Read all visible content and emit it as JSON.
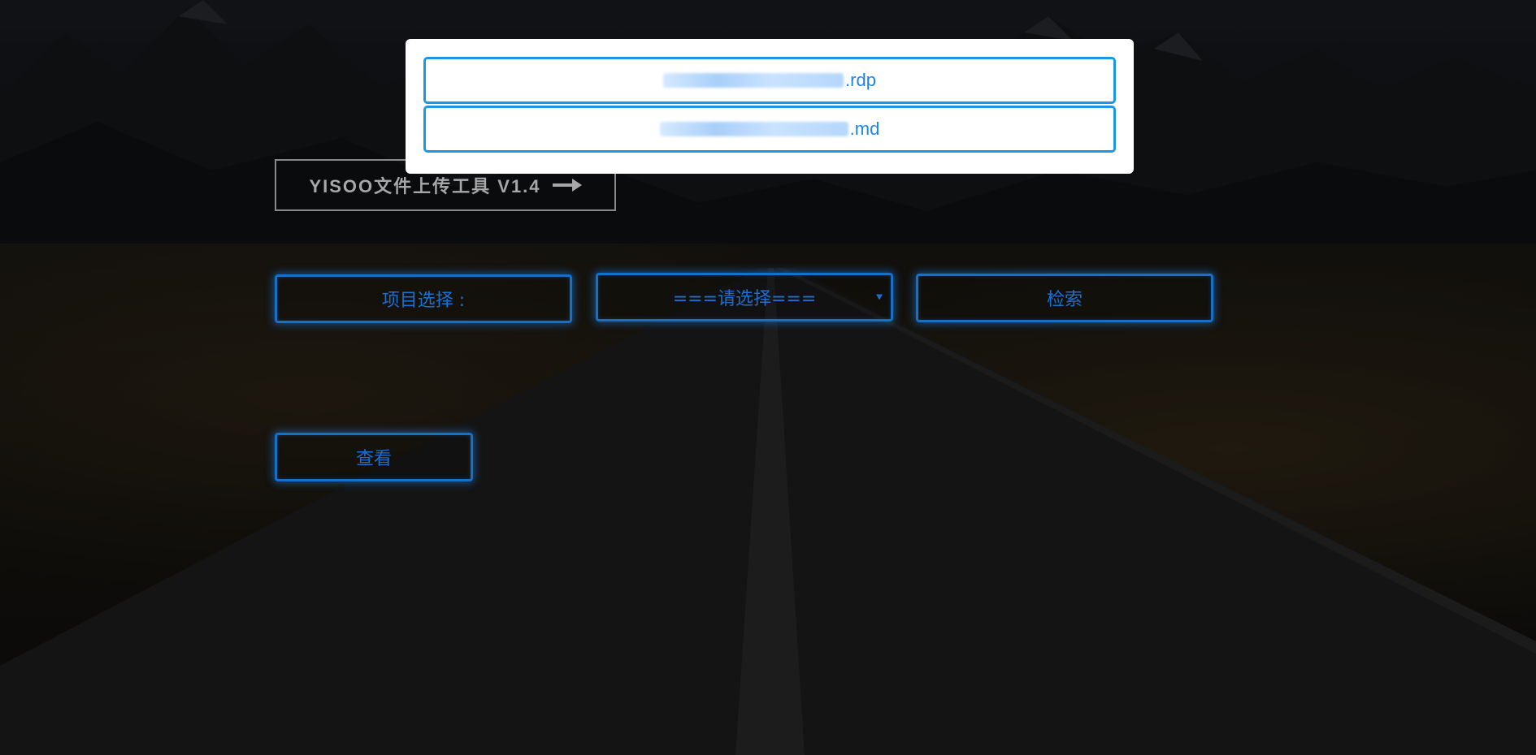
{
  "app": {
    "title_text": "YISOO文件上传工具 V1.4"
  },
  "form": {
    "project_label": "项目选择 :",
    "project_select_value": "===请选择===",
    "search_label": "检索",
    "view_label": "查看"
  },
  "popup": {
    "files": [
      {
        "visible_name": ".rdp"
      },
      {
        "visible_name": ".md"
      }
    ]
  },
  "colors": {
    "accent_blue": "#1570c8",
    "popup_border_blue": "#1e96e8",
    "title_gray": "#a7a7a7"
  },
  "icons": {
    "title_arrow": "arrow-right-icon",
    "select_caret": "caret-down-icon"
  }
}
